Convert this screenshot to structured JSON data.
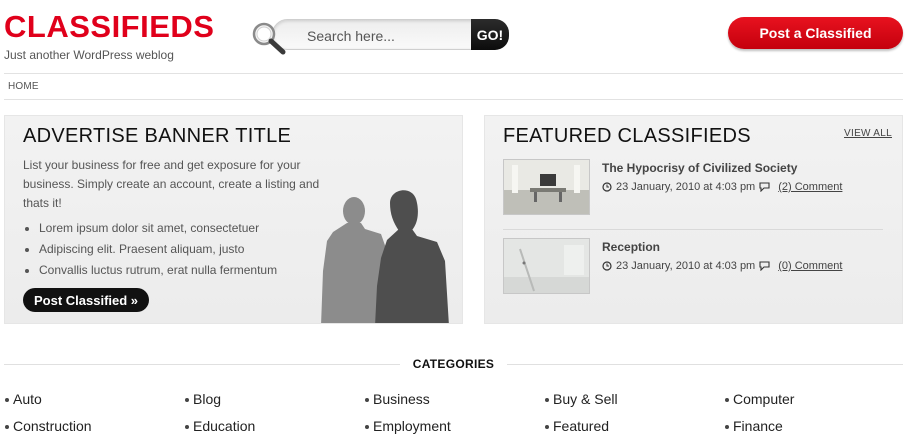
{
  "site": {
    "logo": "CLASSIFIEDS",
    "tagline": "Just another WordPress weblog",
    "accent": "#e0001b"
  },
  "search": {
    "placeholder": "Search here...",
    "button": "GO!"
  },
  "header": {
    "post_button": "Post a Classified"
  },
  "breadcrumb": {
    "home": "HOME"
  },
  "banner": {
    "title": "ADVERTISE BANNER TITLE",
    "text": "List your business for free and get exposure for your business. Simply create an account, create a listing and thats it!",
    "bullets": [
      "Lorem ipsum dolor sit amet, consectetuer",
      "Adipiscing elit. Praesent aliquam, justo",
      "Convallis luctus rutrum, erat nulla fermentum"
    ],
    "button": "Post Classified »"
  },
  "featured": {
    "title": "FEATURED CLASSIFIEDS",
    "view_all": "VIEW ALL",
    "items": [
      {
        "title": "The Hypocrisy of Civilized Society",
        "date": "23 January, 2010 at 4:03 pm",
        "comments": "(2) Comment"
      },
      {
        "title": "Reception",
        "date": "23 January, 2010 at 4:03 pm",
        "comments": "(0) Comment"
      }
    ]
  },
  "categories": {
    "heading": "CATEGORIES",
    "row1": [
      "Auto",
      "Blog",
      "Business",
      "Buy & Sell",
      "Computer"
    ],
    "row2": [
      "Construction",
      "Education",
      "Employment",
      "Featured",
      "Finance"
    ]
  }
}
